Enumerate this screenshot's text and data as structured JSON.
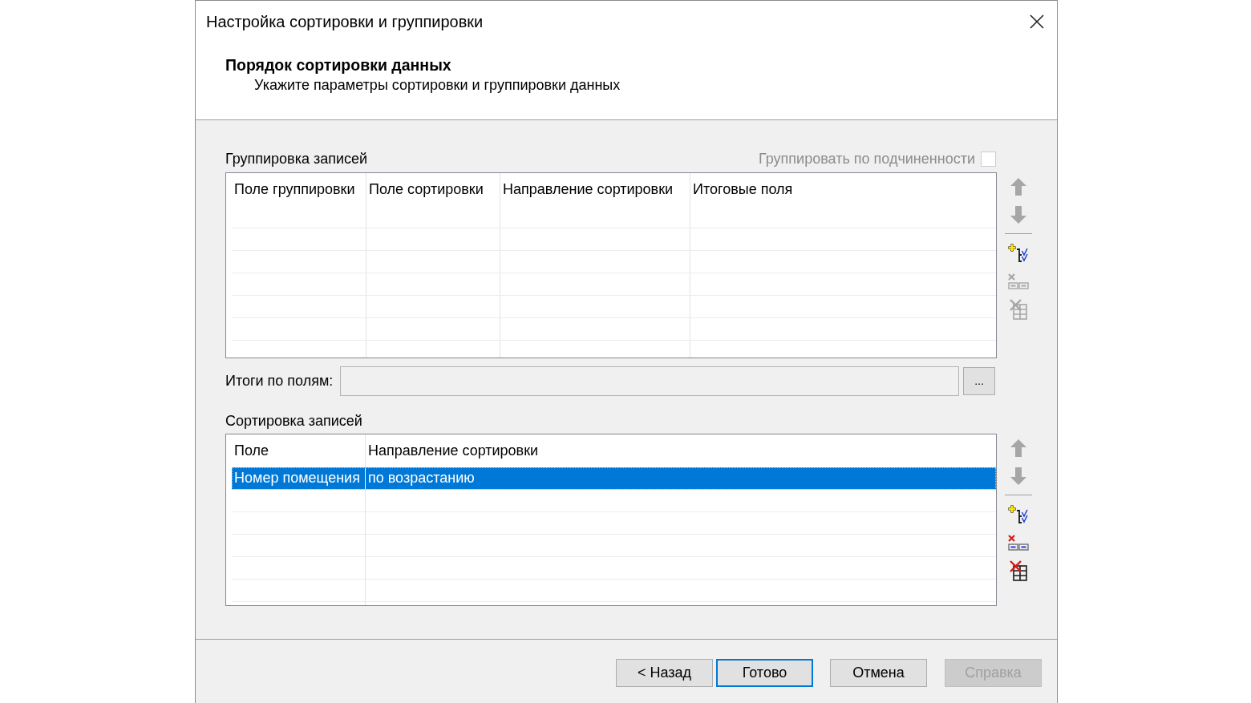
{
  "window": {
    "title": "Настройка сортировки и группировки"
  },
  "header": {
    "heading": "Порядок сортировки данных",
    "description": "Укажите параметры сортировки и группировки данных"
  },
  "grouping": {
    "label": "Группировка записей",
    "group_by_subordination": {
      "label": "Группировать по подчиненности",
      "checked": false,
      "disabled": true
    },
    "table": {
      "columns": [
        "Поле группировки",
        "Поле сортировки",
        "Направление сортировки",
        "Итоговые поля"
      ]
    },
    "toolbar": [
      {
        "kind": "move-up",
        "disabled": true
      },
      {
        "kind": "move-down",
        "disabled": true
      },
      {
        "kind": "separator"
      },
      {
        "kind": "add",
        "disabled": false
      },
      {
        "kind": "remove",
        "disabled": true
      },
      {
        "kind": "delete",
        "disabled": true
      }
    ]
  },
  "totals": {
    "label": "Итоги по полям:",
    "field": {
      "disabled": true
    },
    "browse_button": "..."
  },
  "sorting": {
    "label": "Сортировка записей",
    "table": {
      "columns": [
        "Поле",
        "Направление сортировки"
      ],
      "rows": [
        {
          "cells": [
            "Номер помещения",
            "по возрастанию"
          ],
          "selected": true
        }
      ]
    },
    "toolbar": [
      {
        "kind": "move-up",
        "disabled": true
      },
      {
        "kind": "move-down",
        "disabled": true
      },
      {
        "kind": "separator"
      },
      {
        "kind": "add",
        "disabled": false
      },
      {
        "kind": "remove",
        "disabled": false
      },
      {
        "kind": "delete",
        "disabled": false
      }
    ]
  },
  "buttons": [
    {
      "label": "< Назад",
      "default": false,
      "disabled": false
    },
    {
      "label": "Готово",
      "default": true,
      "disabled": false
    },
    {
      "label": "Отмена",
      "default": false,
      "disabled": false
    },
    {
      "label": "Справка",
      "default": false,
      "disabled": true
    }
  ]
}
